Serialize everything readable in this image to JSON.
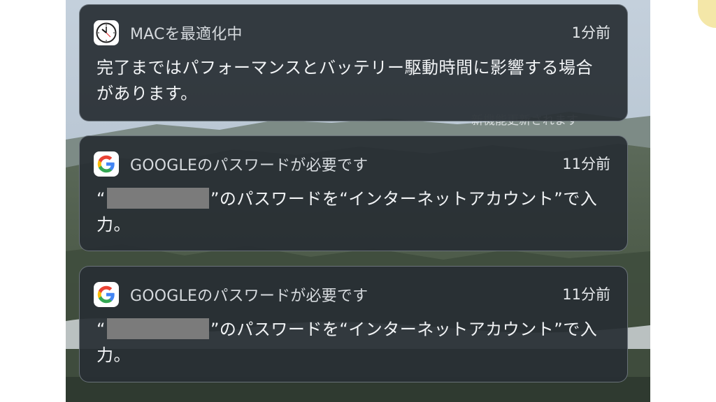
{
  "notifications": [
    {
      "app": "MACを最適化中",
      "time": "1分前",
      "icon": "clock-icon",
      "body": "完了まではパフォーマンスとバッテリー駆動時間に影響する場合があります。"
    },
    {
      "app": "GOOGLEのパスワードが必要です",
      "time": "11分前",
      "icon": "google-icon",
      "quote_open": "“",
      "body_rest": "”のパスワードを“インターネットアカウント”で入力。"
    },
    {
      "app": "GOOGLEのパスワードが必要です",
      "time": "11分前",
      "icon": "google-icon",
      "quote_open": "“",
      "body_rest": "”のパスワードを“インターネットアカウント”で入力。"
    }
  ],
  "background_text": "新機能更新されます"
}
